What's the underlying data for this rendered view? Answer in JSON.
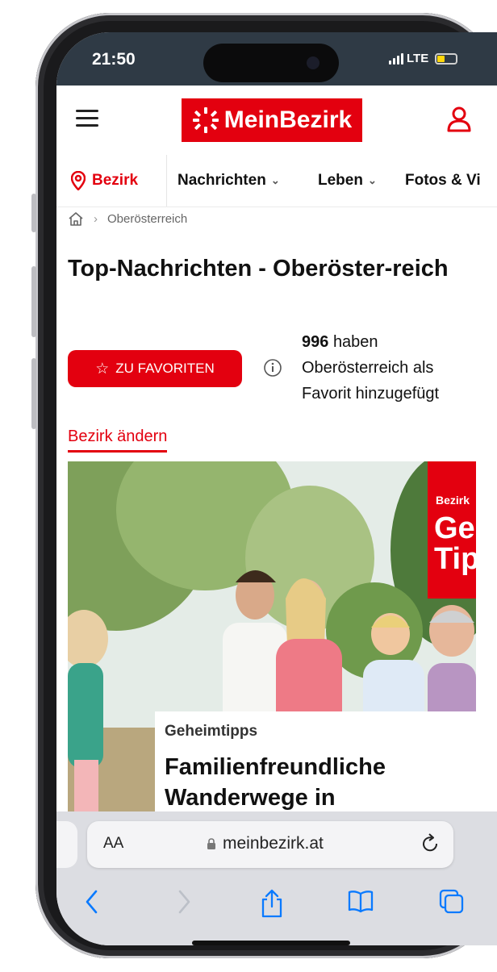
{
  "status_bar": {
    "time": "21:50",
    "network": "LTE"
  },
  "header": {
    "logo_text": "MeinBezirk",
    "menu_icon": "hamburger-icon",
    "account_icon": "user-icon"
  },
  "nav": {
    "bezirk_label": "Bezirk",
    "items": [
      {
        "label": "Nachrichten"
      },
      {
        "label": "Leben"
      },
      {
        "label": "Fotos & Vi"
      }
    ]
  },
  "breadcrumb": {
    "home_icon": "home-icon",
    "current": "Oberösterreich"
  },
  "page": {
    "title": "Top-Nachrichten - Oberöster-reich",
    "favorite_button": "ZU FAVORITEN",
    "favorite_count": "996",
    "favorite_text": "haben Oberösterreich als Favorit hinzugefügt",
    "change_bezirk": "Bezirk ändern"
  },
  "article": {
    "badge_small": "Bezirk",
    "badge_large": "Ge Tip",
    "category": "Geheimtipps",
    "title": "Familienfreundliche Wanderwege in"
  },
  "safari": {
    "aa": "AA",
    "url": "meinbezirk.at"
  },
  "colors": {
    "brand_red": "#e3000f",
    "status_bar": "#2f3a45",
    "toolbar": "#dcdde2",
    "link_blue": "#0a7aff"
  }
}
